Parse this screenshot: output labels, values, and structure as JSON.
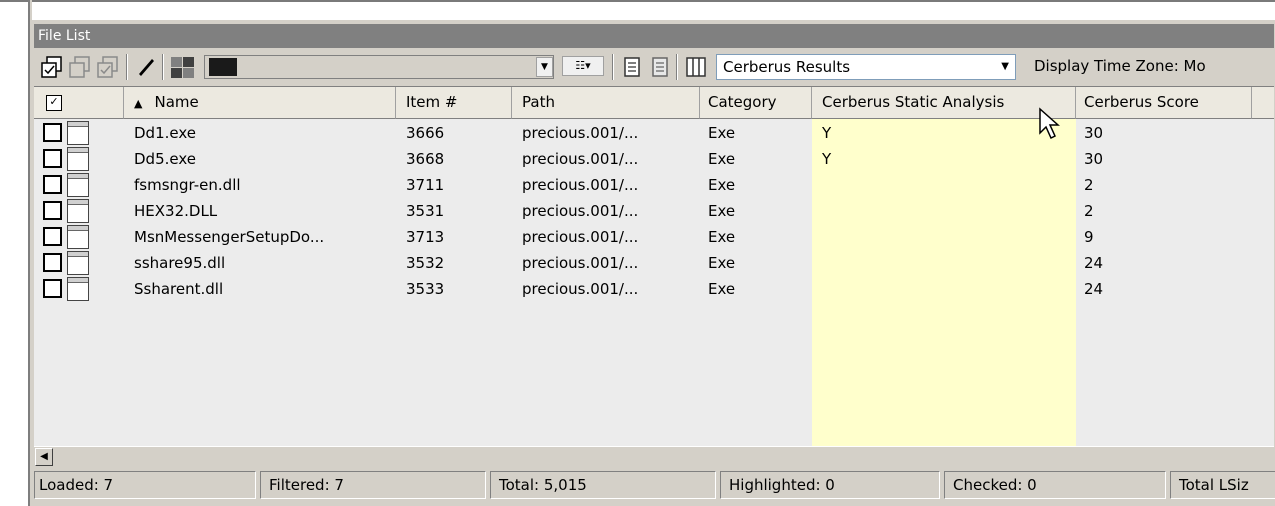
{
  "panel": {
    "title": "File List"
  },
  "toolbar": {
    "report_view": "Cerberus Results",
    "timezone_label": "Display Time Zone: Mo"
  },
  "columns": [
    {
      "label": "Name"
    },
    {
      "label": "Item #"
    },
    {
      "label": "Path"
    },
    {
      "label": "Category"
    },
    {
      "label": "Cerberus Static Analysis"
    },
    {
      "label": "Cerberus Score"
    }
  ],
  "rows": [
    {
      "name": "Dd1.exe",
      "item": "3666",
      "path": "precious.001/...",
      "category": "Exe",
      "static": "Y",
      "score": "30"
    },
    {
      "name": "Dd5.exe",
      "item": "3668",
      "path": "precious.001/...",
      "category": "Exe",
      "static": "Y",
      "score": "30"
    },
    {
      "name": "fsmsngr-en.dll",
      "item": "3711",
      "path": "precious.001/...",
      "category": "Exe",
      "static": "",
      "score": "2"
    },
    {
      "name": "HEX32.DLL",
      "item": "3531",
      "path": "precious.001/...",
      "category": "Exe",
      "static": "",
      "score": "2"
    },
    {
      "name": "MsnMessengerSetupDo...",
      "item": "3713",
      "path": "precious.001/...",
      "category": "Exe",
      "static": "",
      "score": "9"
    },
    {
      "name": "sshare95.dll",
      "item": "3532",
      "path": "precious.001/...",
      "category": "Exe",
      "static": "",
      "score": "24"
    },
    {
      "name": "Ssharent.dll",
      "item": "3533",
      "path": "precious.001/...",
      "category": "Exe",
      "static": "",
      "score": "24"
    }
  ],
  "status": {
    "loaded": "Loaded: 7",
    "filtered": "Filtered: 7",
    "total": "Total: 5,015",
    "highlighted": "Highlighted: 0",
    "checked": "Checked: 0",
    "total_lsize": "Total LSiz"
  },
  "colors": {
    "highlight_column": "#ffffcc",
    "header_bar": "#808080"
  }
}
